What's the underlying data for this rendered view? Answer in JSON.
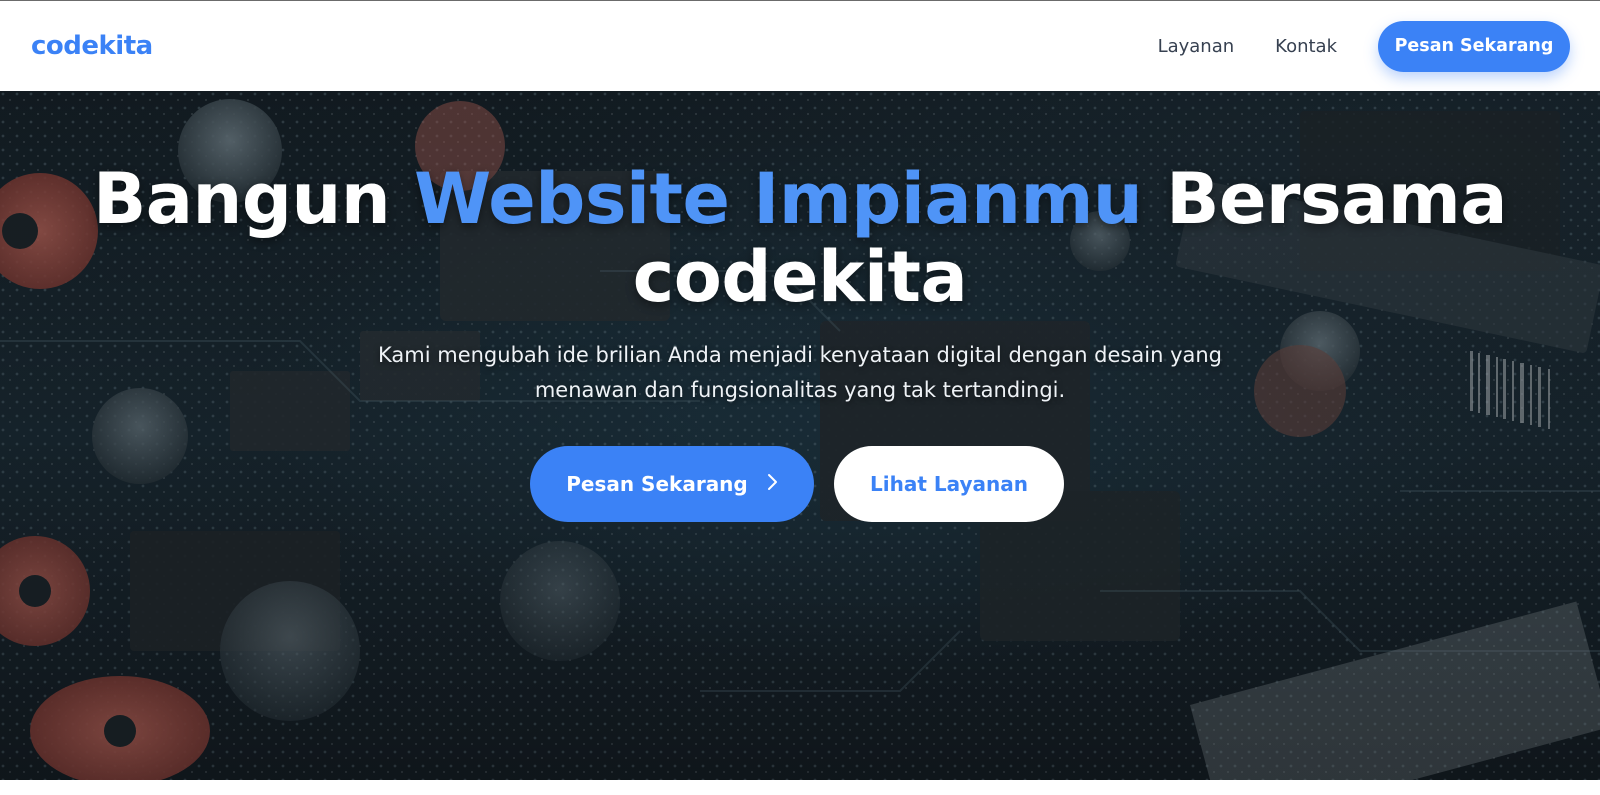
{
  "navbar": {
    "brand": "codekita",
    "links": [
      "Layanan",
      "Kontak"
    ],
    "cta_label": "Pesan Sekarang"
  },
  "hero": {
    "title_part1": "Bangun ",
    "title_accent": "Website Impianmu",
    "title_part2": " Bersama codekita",
    "subtitle": "Kami mengubah ide brilian Anda menjadi kenyataan digital dengan desain yang menawan dan fungsionalitas yang tak tertandingi.",
    "primary_button": "Pesan Sekarang",
    "primary_button_icon": "chevron-right-icon",
    "secondary_button": "Lihat Layanan",
    "background_image": "circuit-board-photo"
  },
  "colors": {
    "accent": "#3b82f6",
    "accent_light": "#4f94f7",
    "nav_text": "#374151"
  }
}
